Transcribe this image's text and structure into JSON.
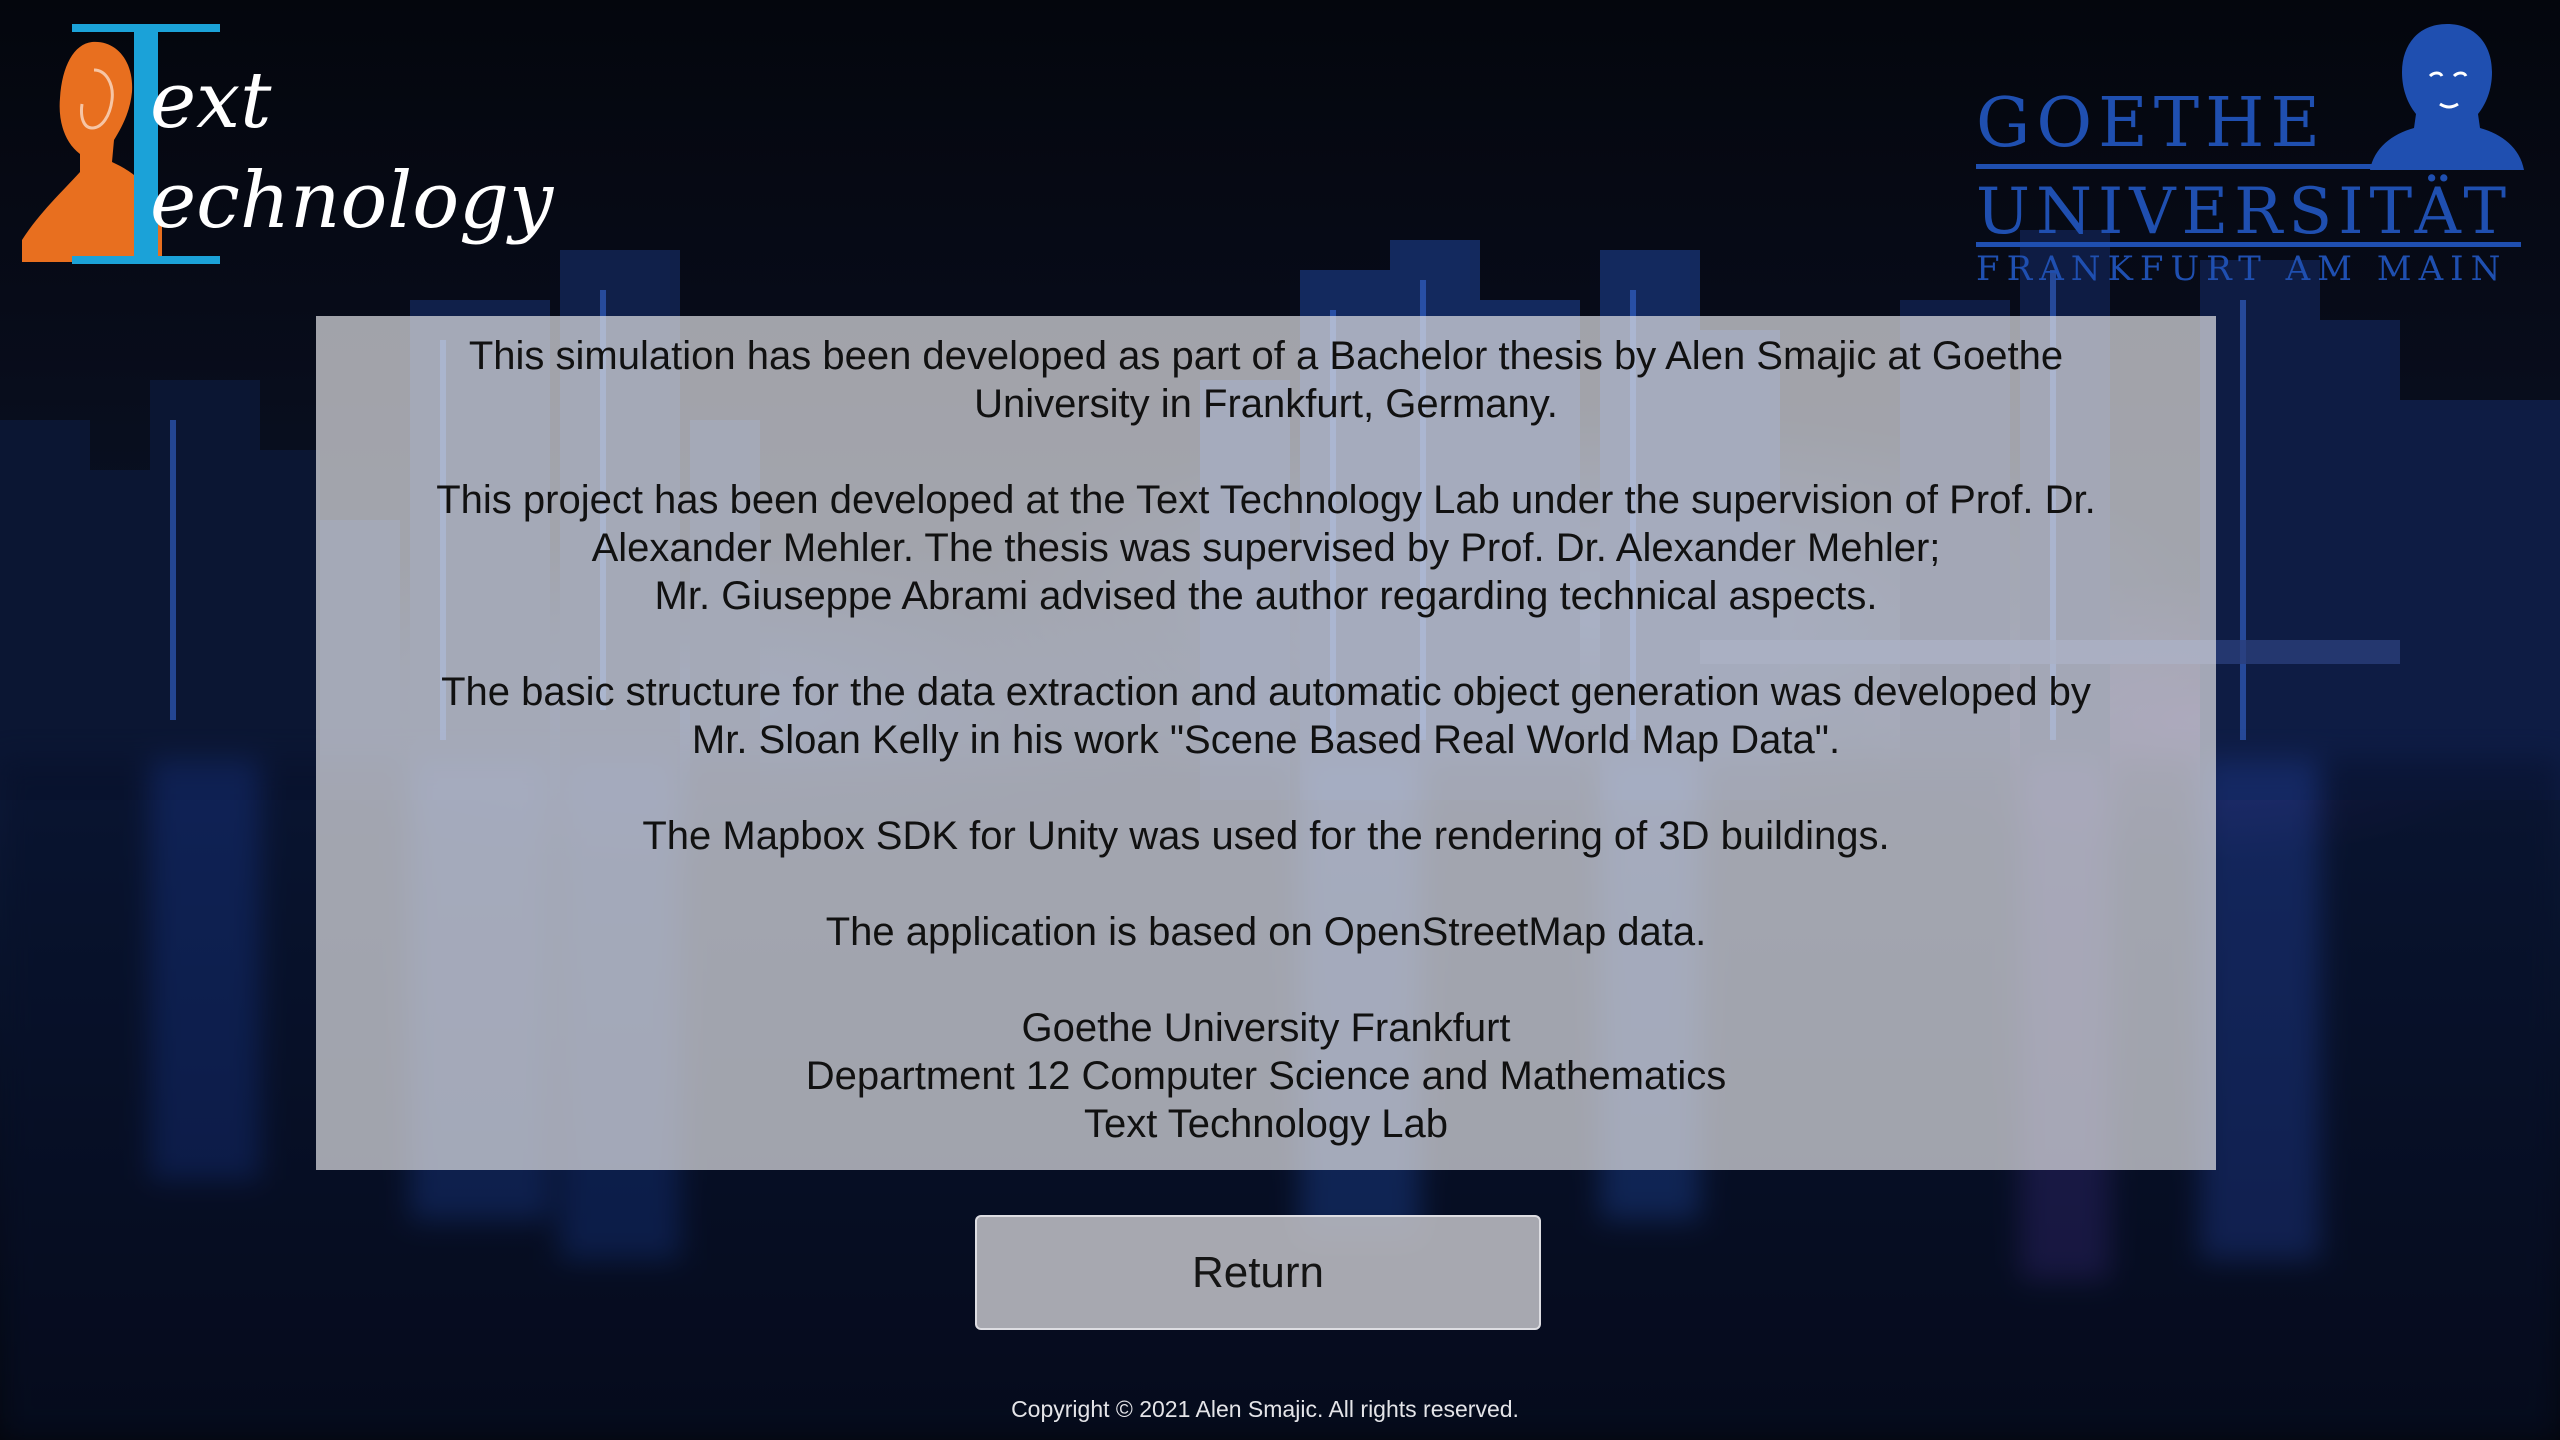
{
  "background": {
    "description_icon": "night-city-skyline-background",
    "accent_colors": [
      "#1b2f6b",
      "#2f63d6",
      "#6b3fa3"
    ]
  },
  "logos": {
    "text_technology": {
      "line_1": "ext",
      "line_2": "echnology",
      "icon": "goethe-portrait-icon",
      "bar_color": "#1ba2d8",
      "portrait_color": "#e86f1f"
    },
    "goethe_university": {
      "line_1": "GOETHE",
      "line_2": "UNIVERSITÄT",
      "line_3": "FRANKFURT AM MAIN",
      "icon": "goethe-portrait-icon",
      "color": "#1f4fb0"
    }
  },
  "info": {
    "paragraphs": [
      {
        "lines": [
          "This simulation has been developed as part of a Bachelor thesis by Alen Smajic at Goethe",
          "University in Frankfurt, Germany."
        ]
      },
      {
        "lines": [
          "This project has been developed at the Text Technology Lab under the supervision of Prof. Dr.",
          "Alexander Mehler. The thesis was supervised by Prof. Dr. Alexander Mehler;",
          "Mr. Giuseppe Abrami advised the author regarding technical aspects."
        ]
      },
      {
        "lines": [
          "The basic structure for the data extraction and automatic object generation was developed by",
          "Mr. Sloan Kelly in his work \"Scene Based Real World Map Data\"."
        ]
      },
      {
        "lines": [
          "The Mapbox SDK for Unity was used for the rendering of 3D buildings."
        ]
      },
      {
        "lines": [
          "The application is based on OpenStreetMap data."
        ]
      },
      {
        "lines": [
          "Goethe University Frankfurt",
          "Department 12 Computer Science and Mathematics",
          "Text Technology Lab"
        ]
      }
    ]
  },
  "return_button": {
    "label": "Return"
  },
  "footer": {
    "copyright": "Copyright © 2021 Alen Smajic. All rights reserved."
  }
}
